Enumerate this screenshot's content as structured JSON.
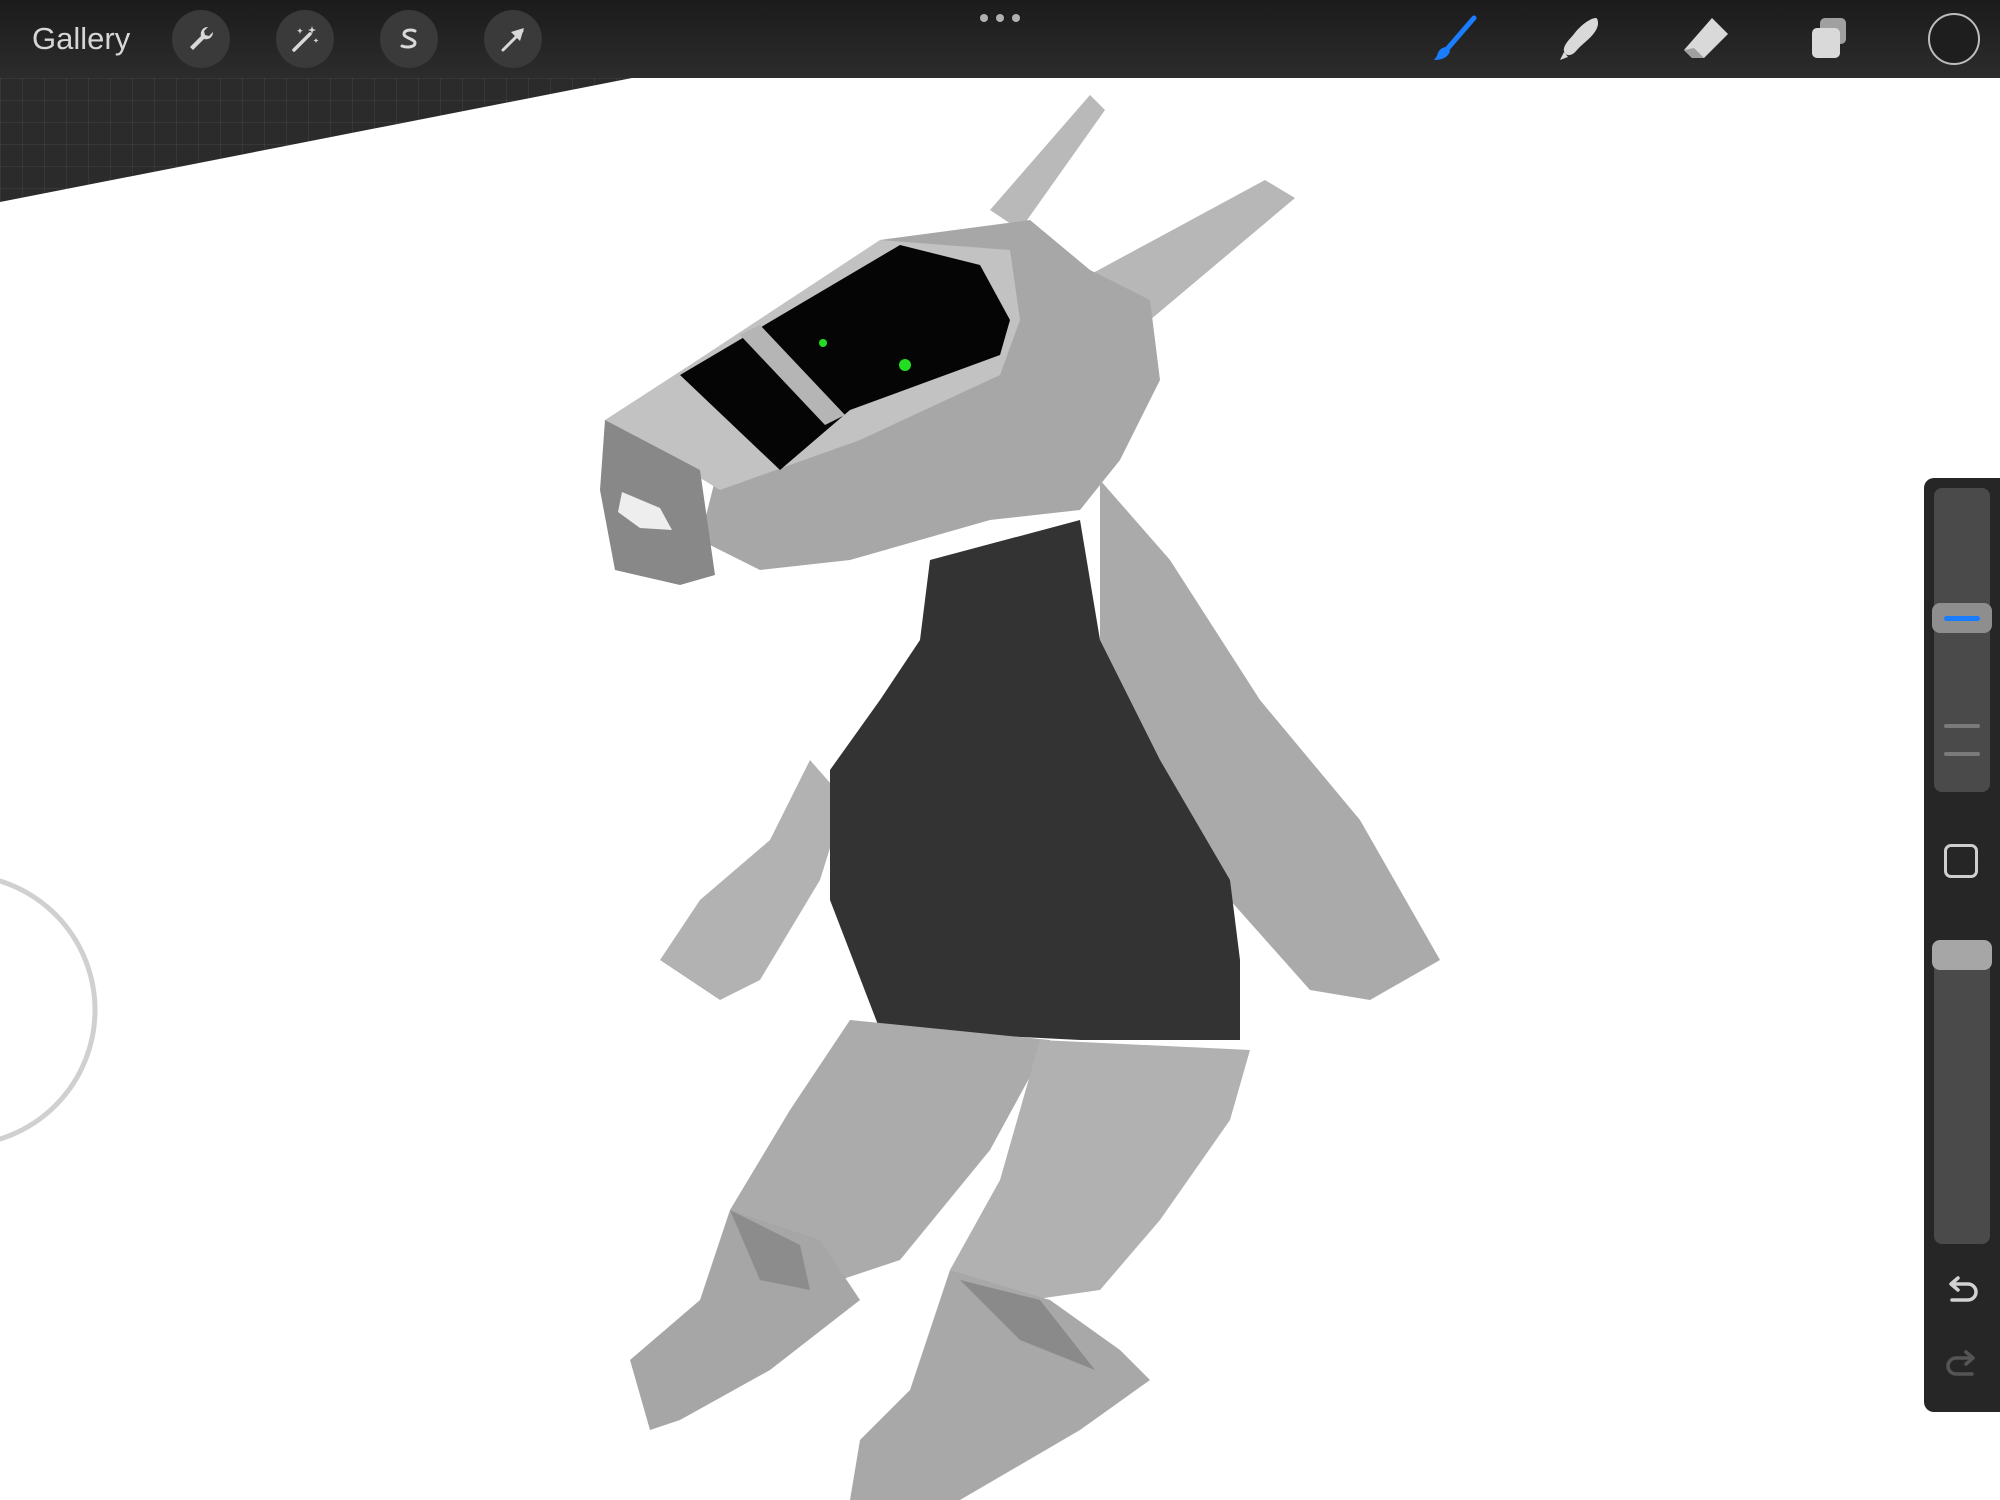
{
  "app": {
    "gallery_label": "Gallery"
  },
  "toolbar": {
    "left_icons": [
      "wrench-icon",
      "magic-wand-icon",
      "selection-s-icon",
      "transform-arrow-icon"
    ],
    "center_icon": "more-dots-icon",
    "right_icons": [
      "brush-icon",
      "smudge-icon",
      "eraser-icon",
      "layers-icon"
    ],
    "active_tool": "brush",
    "accent_color": "#1a7cff",
    "current_color": "#1e1e1e"
  },
  "sidebar": {
    "brush_size_level": 0.58,
    "opacity_level": 1.0,
    "icons": [
      "modify-square-icon",
      "undo-icon",
      "redo-icon"
    ]
  },
  "canvas": {
    "background_color": "#ffffff",
    "accent_dot_color": "#22dd22"
  }
}
